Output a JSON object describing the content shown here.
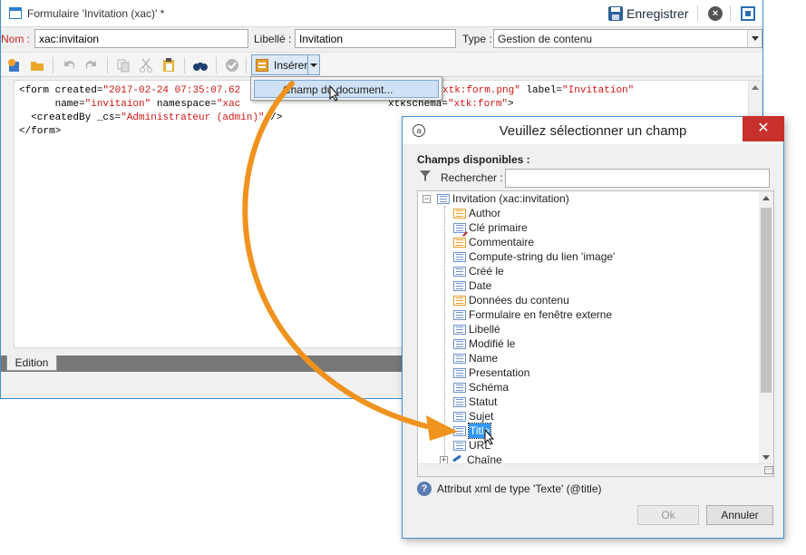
{
  "main_window": {
    "title": "Formulaire 'Invitation (xac)' *",
    "save_label": "Enregistrer",
    "close_symbol": "×"
  },
  "fields": {
    "nom_label": "Nom :",
    "nom_value": "xac:invitaion",
    "libelle_label": "Libellé :",
    "libelle_value": "Invitation",
    "type_label": "Type :",
    "type_value": "Gestion de contenu"
  },
  "toolbar": {
    "insert_label": "Insérer",
    "tools": [
      "new-icon",
      "open-folder-icon",
      "undo-icon",
      "redo-icon",
      "copy-icon",
      "cut-icon",
      "paste-icon",
      "binoculars-icon",
      "check-icon"
    ]
  },
  "insert_menu": {
    "item_label": "Champ du document..."
  },
  "editor": {
    "line1_a": "<form created=",
    "line1_b": "\"2017-02-24 07:35:07.62",
    "line1_c": "xtk:form.png\"",
    "line1_d": " label=",
    "line1_e": "\"Invitation\"",
    "line2_a": "      name=",
    "line2_b": "\"invitaion\"",
    "line2_c": " namespace=",
    "line2_d": "\"xac",
    "line2_e": "xtkschema=",
    "line2_f": "\"xtk:form\"",
    "line2_g": ">",
    "line3_a": "  <createdBy _cs=",
    "line3_b": "\"Administrateur (admin)\"",
    "line3_c": " />",
    "line4": "</form>",
    "tab_label": "Edition"
  },
  "dialog": {
    "title": "Veuillez sélectionner un champ",
    "close_symbol": "✕",
    "available_label": "Champs disponibles :",
    "search_label": "Rechercher :",
    "search_value": "",
    "tree_root": "Invitation (xac:invitation)",
    "tree_items": [
      {
        "label": "Author",
        "icon": "orange"
      },
      {
        "label": "Clé primaire",
        "icon": "key"
      },
      {
        "label": "Commentaire",
        "icon": "orange"
      },
      {
        "label": "Compute-string du lien 'image'",
        "icon": "blue"
      },
      {
        "label": "Créé le",
        "icon": "blue"
      },
      {
        "label": "Date",
        "icon": "blue"
      },
      {
        "label": "Données du contenu",
        "icon": "orange"
      },
      {
        "label": "Formulaire en fenêtre externe",
        "icon": "blue"
      },
      {
        "label": "Libellé",
        "icon": "blue"
      },
      {
        "label": "Modifié le",
        "icon": "blue"
      },
      {
        "label": "Name",
        "icon": "blue"
      },
      {
        "label": "Presentation",
        "icon": "blue"
      },
      {
        "label": "Schéma",
        "icon": "blue"
      },
      {
        "label": "Statut",
        "icon": "blue"
      },
      {
        "label": "Sujet",
        "icon": "blue"
      },
      {
        "label": "Title",
        "icon": "blue"
      },
      {
        "label": "URL",
        "icon": "blue"
      },
      {
        "label": "Chaîne",
        "icon": "link"
      }
    ],
    "selected_item": "Title",
    "info_text": "Attribut xml de type 'Texte' (@title)",
    "ok_label": "Ok",
    "cancel_label": "Annuler"
  },
  "colors": {
    "accent": "#3c8fd4",
    "annotation_arrow": "#f0921e",
    "selection": "#3399ff",
    "close_red": "#c7302b"
  }
}
